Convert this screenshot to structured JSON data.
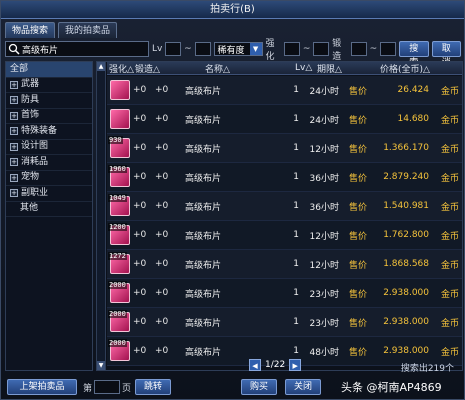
{
  "window": {
    "title": "拍卖行(B)"
  },
  "tabs": [
    {
      "label": "物品搜索",
      "active": true
    },
    {
      "label": "我的拍卖品",
      "active": false
    }
  ],
  "filters": {
    "search_value": "高级布片",
    "lv_label": "Lv",
    "tilde": "~",
    "rarity_value": "稀有度",
    "enhance_label": "强化",
    "forge_label": "锻造",
    "search_button": "搜索",
    "partial_button": "取消"
  },
  "categories": [
    {
      "label": "全部",
      "selected": true,
      "expandable": false
    },
    {
      "label": "武器",
      "selected": false,
      "expandable": true
    },
    {
      "label": "防具",
      "selected": false,
      "expandable": true
    },
    {
      "label": "首饰",
      "selected": false,
      "expandable": true
    },
    {
      "label": "特殊装备",
      "selected": false,
      "expandable": true
    },
    {
      "label": "设计图",
      "selected": false,
      "expandable": true
    },
    {
      "label": "消耗品",
      "selected": false,
      "expandable": true
    },
    {
      "label": "宠物",
      "selected": false,
      "expandable": true
    },
    {
      "label": "副职业",
      "selected": false,
      "expandable": true
    },
    {
      "label": "其他",
      "selected": false,
      "expandable": false
    }
  ],
  "columns": {
    "enhance": "强化△",
    "forge": "锻造△",
    "name": "名称△",
    "lv": "Lv△",
    "time": "期限△",
    "price": "价格(全币)△"
  },
  "rows": [
    {
      "qty": "",
      "enhance": "+0",
      "forge": "+0",
      "name": "高级布片",
      "lv": "1",
      "time": "24小时",
      "sell": "售价",
      "price": "26.424",
      "unit": "金币"
    },
    {
      "qty": "",
      "enhance": "+0",
      "forge": "+0",
      "name": "高级布片",
      "lv": "1",
      "time": "24小时",
      "sell": "售价",
      "price": "14.680",
      "unit": "金币"
    },
    {
      "qty": "930",
      "enhance": "+0",
      "forge": "+0",
      "name": "高级布片",
      "lv": "1",
      "time": "12小时",
      "sell": "售价",
      "price": "1.366.170",
      "unit": "金币"
    },
    {
      "qty": "1960",
      "enhance": "+0",
      "forge": "+0",
      "name": "高级布片",
      "lv": "1",
      "time": "36小时",
      "sell": "售价",
      "price": "2.879.240",
      "unit": "金币"
    },
    {
      "qty": "1049",
      "enhance": "+0",
      "forge": "+0",
      "name": "高级布片",
      "lv": "1",
      "time": "36小时",
      "sell": "售价",
      "price": "1.540.981",
      "unit": "金币"
    },
    {
      "qty": "1200",
      "enhance": "+0",
      "forge": "+0",
      "name": "高级布片",
      "lv": "1",
      "time": "12小时",
      "sell": "售价",
      "price": "1.762.800",
      "unit": "金币"
    },
    {
      "qty": "1272",
      "enhance": "+0",
      "forge": "+0",
      "name": "高级布片",
      "lv": "1",
      "time": "12小时",
      "sell": "售价",
      "price": "1.868.568",
      "unit": "金币"
    },
    {
      "qty": "2000",
      "enhance": "+0",
      "forge": "+0",
      "name": "高级布片",
      "lv": "1",
      "time": "23小时",
      "sell": "售价",
      "price": "2.938.000",
      "unit": "金币"
    },
    {
      "qty": "2000",
      "enhance": "+0",
      "forge": "+0",
      "name": "高级布片",
      "lv": "1",
      "time": "23小时",
      "sell": "售价",
      "price": "2.938.000",
      "unit": "金币"
    },
    {
      "qty": "2000",
      "enhance": "+0",
      "forge": "+0",
      "name": "高级布片",
      "lv": "1",
      "time": "48小时",
      "sell": "售价",
      "price": "2.938.000",
      "unit": "金币"
    }
  ],
  "pager": {
    "text": "1/22",
    "prev": "◀",
    "next": "▶"
  },
  "result_count": "搜索出219个",
  "bottom": {
    "list_item_button": "上架拍卖品",
    "page_prefix": "第",
    "page_suffix": "页",
    "jump_button": "跳转",
    "buy_button": "购买",
    "close_button": "关闭",
    "watermark": "头条 @柯南AP4869"
  },
  "colors": {
    "accent": "#2f5fae",
    "price": "#f5c33b",
    "item": "#d91e6b"
  }
}
